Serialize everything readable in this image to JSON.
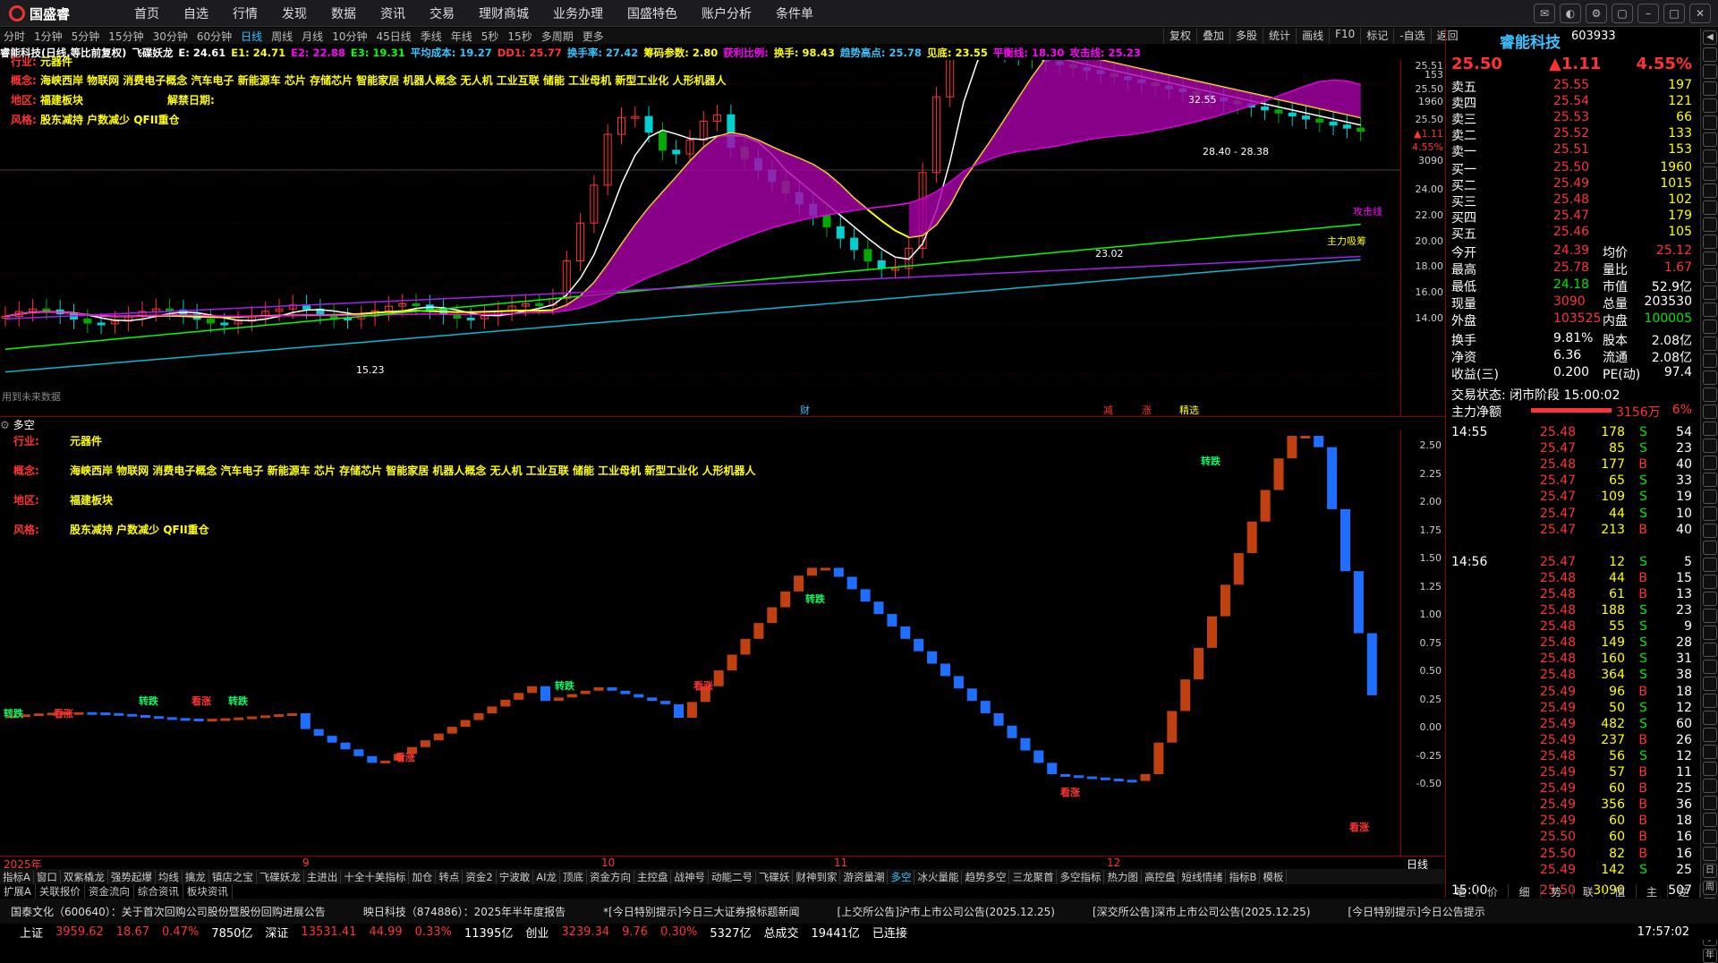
{
  "app": {
    "logo": "国盛睿"
  },
  "menu": [
    "首页",
    "自选",
    "行情",
    "发现",
    "数据",
    "资讯",
    "交易",
    "理财商城",
    "业务办理",
    "国盛特色",
    "账户分析",
    "条件单"
  ],
  "periods": [
    "分时",
    "1分钟",
    "5分钟",
    "15分钟",
    "30分钟",
    "60分钟",
    "日线",
    "周线",
    "月线",
    "10分钟",
    "45日线",
    "季线",
    "年线",
    "5秒",
    "15秒",
    "多周期",
    "更多"
  ],
  "active_period": "日线",
  "tools": [
    "复权",
    "叠加",
    "多股",
    "统计",
    "画线",
    "F10",
    "标记",
    "-自选",
    "返回"
  ],
  "ma_bar": [
    {
      "t": "睿能科技(日线,等比前复权)",
      "c": "#ffffff"
    },
    {
      "t": "飞碟妖龙",
      "c": "#ffffff"
    },
    {
      "t": "E: 24.61",
      "c": "#ffffff"
    },
    {
      "t": "E1: 24.71",
      "c": "#ffff00"
    },
    {
      "t": "E2: 22.88",
      "c": "#ff00ff"
    },
    {
      "t": "E3: 19.31",
      "c": "#00ff00"
    },
    {
      "t": "平均成本: 19.27",
      "c": "#37c3ff"
    },
    {
      "t": "DD1: 25.77",
      "c": "#ff3333"
    },
    {
      "t": "换手率: 27.42",
      "c": "#37c3ff"
    },
    {
      "t": "筹码参数: 2.80",
      "c": "#ffff00"
    },
    {
      "t": "获利比例:",
      "c": "#ff00ff"
    },
    {
      "t": "换手: 98.43",
      "c": "#ffff00"
    },
    {
      "t": "趋势高点: 25.78",
      "c": "#37c3ff"
    },
    {
      "t": "见底: 23.55",
      "c": "#ffff00"
    },
    {
      "t": "平衡线: 18.30",
      "c": "#ff00ff"
    },
    {
      "t": "攻击线: 25.23",
      "c": "#ff00ff"
    }
  ],
  "stock_info": {
    "industry_k": "行业:",
    "industry_v": "元器件",
    "concept_k": "概念:",
    "concept_v": "海峡西岸 物联网 消费电子概念 汽车电子 新能源车 芯片 存储芯片 智能家居 机器人概念 无人机 工业互联 储能 工业母机 新型工业化 人形机器人",
    "region_k": "地区:",
    "region_v": "福建板块",
    "unban_k": "解禁日期:",
    "style_k": "风格:",
    "style_v": "股东减持 户数减少 QFII重仓"
  },
  "kaxis": [
    "25.51",
    "153",
    "25.50",
    "1960",
    "25.50",
    "▲1.11",
    "4.55%",
    "3090",
    "24.00",
    "22.00",
    "20.00",
    "18.00",
    "16.00",
    "14.00"
  ],
  "k_labels": {
    "high": "32.55",
    "low": "15.23",
    "range": "28.40 - 28.38",
    "r2": "23.02",
    "nofuture": "用到未来数据",
    "attack": "攻击线",
    "mainforce": "主力吸筹",
    "jian": "减",
    "zhang": "涨",
    "cai": "财",
    "jingxuan": "精选"
  },
  "sub_title": "多空",
  "sub_axis": [
    "2.50",
    "2.25",
    "2.00",
    "1.75",
    "1.50",
    "1.25",
    "1.00",
    "0.75",
    "0.50",
    "0.25",
    "0.00",
    "-0.25",
    "-0.50"
  ],
  "sub_labels": {
    "up": "看涨",
    "down": "转跌"
  },
  "dates": [
    "2025年",
    "9",
    "10",
    "11",
    "12"
  ],
  "date_period": "日线",
  "ind_tabs": [
    "指标A",
    "窗口",
    "双紫橇龙",
    "强势起爆",
    "均线",
    "擒龙",
    "镇店之宝",
    "飞碟妖龙",
    "主进出",
    "十全十美指标",
    "加仓",
    "转点",
    "资金2",
    "宁波敢",
    "AI龙",
    "顶底",
    "资金方向",
    "主控盘",
    "战神号",
    "动能二号",
    "飞碟妖",
    "财神到家",
    "游资量潮",
    "多空",
    "冰火量能",
    "趋势多空",
    "三龙聚首",
    "多空指标",
    "热力图",
    "高控盘",
    "短线情绪",
    "指标B",
    "模板"
  ],
  "bot_tabs": [
    "扩展A",
    "关联报价",
    "资金流向",
    "综合资讯",
    "板块资讯"
  ],
  "ticker": [
    "国泰文化（600640）：关于首次回购公司股份暨股份回购进展公告",
    "映日科技（874886）：2025年半年度报告",
    "*[今日特别提示]今日三大证券报标题新闻",
    "[上交所公告]沪市上市公司公告(2025.12.25)",
    "[深交所公告]深市上市公司公告(2025.12.25)",
    "[今日特别提示]今日公告提示"
  ],
  "status": {
    "sh": "上证",
    "sh_v": "3959.62",
    "sh_c": "18.67",
    "sh_p": "0.47%",
    "sh_a": "7850亿",
    "sz": "深证",
    "sz_v": "13531.41",
    "sz_c": "44.99",
    "sz_p": "0.33%",
    "sz_a": "11395亿",
    "cy": "创业",
    "cy_v": "3239.34",
    "cy_c": "9.76",
    "cy_p": "0.30%",
    "cy_a": "5327亿",
    "total": "总成交",
    "total_v": "19441亿",
    "conn": "已连接",
    "time": "17:57:02"
  },
  "quote": {
    "name": "睿能科技",
    "code": "603933",
    "price": "25.50",
    "change": "▲1.11",
    "pct": "4.55%",
    "asks": [
      [
        "卖五",
        "25.55",
        "197"
      ],
      [
        "卖四",
        "25.54",
        "121"
      ],
      [
        "卖三",
        "25.53",
        "66"
      ],
      [
        "卖二",
        "25.52",
        "133"
      ],
      [
        "卖一",
        "25.51",
        "153"
      ]
    ],
    "bids": [
      [
        "买一",
        "25.50",
        "1960"
      ],
      [
        "买二",
        "25.49",
        "1015"
      ],
      [
        "买三",
        "25.48",
        "102"
      ],
      [
        "买四",
        "25.47",
        "179"
      ],
      [
        "买五",
        "25.46",
        "105"
      ]
    ],
    "stats": [
      [
        "今开",
        "24.39",
        "均价",
        "25.12"
      ],
      [
        "最高",
        "25.78",
        "量比",
        "1.67"
      ],
      [
        "最低",
        "24.18",
        "市值",
        "52.9亿"
      ],
      [
        "现量",
        "3090",
        "总量",
        "203530"
      ],
      [
        "外盘",
        "103525",
        "内盘",
        "100005"
      ]
    ],
    "stats2": [
      [
        "换手",
        "9.81%",
        "股本",
        "2.08亿"
      ],
      [
        "净资",
        "6.36",
        "流通",
        "2.08亿"
      ],
      [
        "收益(三)",
        "0.200",
        "PE(动)",
        "97.4"
      ]
    ],
    "trade_state": "交易状态: 闭市阶段 15:00:02",
    "mainnet_k": "主力净额",
    "mainnet_v": "3156万",
    "mainnet_p": "6%"
  },
  "ticks": [
    {
      "t": "14:55",
      "p": "25.48",
      "v": "178",
      "s": "S",
      "n": "54"
    },
    {
      "t": "",
      "p": "25.47",
      "v": "85",
      "s": "S",
      "n": "23"
    },
    {
      "t": "",
      "p": "25.48",
      "v": "177",
      "s": "B",
      "n": "40"
    },
    {
      "t": "",
      "p": "25.47",
      "v": "65",
      "s": "S",
      "n": "33"
    },
    {
      "t": "",
      "p": "25.47",
      "v": "109",
      "s": "S",
      "n": "19"
    },
    {
      "t": "",
      "p": "25.47",
      "v": "44",
      "s": "S",
      "n": "10"
    },
    {
      "t": "",
      "p": "25.47",
      "v": "213",
      "s": "B",
      "n": "40"
    },
    {
      "t": "14:56",
      "p": "25.47",
      "v": "12",
      "s": "S",
      "n": "5"
    },
    {
      "t": "",
      "p": "25.48",
      "v": "44",
      "s": "B",
      "n": "15"
    },
    {
      "t": "",
      "p": "25.48",
      "v": "61",
      "s": "B",
      "n": "13"
    },
    {
      "t": "",
      "p": "25.48",
      "v": "188",
      "s": "S",
      "n": "23"
    },
    {
      "t": "",
      "p": "25.48",
      "v": "55",
      "s": "S",
      "n": "9"
    },
    {
      "t": "",
      "p": "25.48",
      "v": "149",
      "s": "S",
      "n": "28"
    },
    {
      "t": "",
      "p": "25.48",
      "v": "160",
      "s": "S",
      "n": "31"
    },
    {
      "t": "",
      "p": "25.48",
      "v": "364",
      "s": "S",
      "n": "38"
    },
    {
      "t": "",
      "p": "25.49",
      "v": "96",
      "s": "B",
      "n": "18"
    },
    {
      "t": "",
      "p": "25.49",
      "v": "50",
      "s": "S",
      "n": "12"
    },
    {
      "t": "",
      "p": "25.49",
      "v": "482",
      "s": "S",
      "n": "60"
    },
    {
      "t": "",
      "p": "25.49",
      "v": "237",
      "s": "B",
      "n": "26"
    },
    {
      "t": "",
      "p": "25.48",
      "v": "56",
      "s": "S",
      "n": "12"
    },
    {
      "t": "",
      "p": "25.49",
      "v": "57",
      "s": "B",
      "n": "11"
    },
    {
      "t": "",
      "p": "25.49",
      "v": "60",
      "s": "B",
      "n": "25"
    },
    {
      "t": "",
      "p": "25.49",
      "v": "356",
      "s": "B",
      "n": "36"
    },
    {
      "t": "",
      "p": "25.49",
      "v": "60",
      "s": "B",
      "n": "18"
    },
    {
      "t": "",
      "p": "25.50",
      "v": "60",
      "s": "B",
      "n": "16"
    },
    {
      "t": "",
      "p": "25.50",
      "v": "82",
      "s": "B",
      "n": "16"
    },
    {
      "t": "",
      "p": "25.49",
      "v": "142",
      "s": "S",
      "n": "25"
    },
    {
      "t": "15:00",
      "p": "25.50",
      "v": "3090",
      "s": "",
      "n": "507"
    }
  ],
  "rb_tabs": [
    "笔",
    "价",
    "细",
    "势",
    "联",
    "值",
    "主",
    "逆"
  ],
  "side": [
    "◀",
    "",
    "",
    "",
    "",
    "",
    "",
    "",
    "",
    "",
    "",
    "",
    "",
    "",
    "",
    "",
    "",
    "",
    "",
    "",
    "",
    "",
    "",
    "",
    "",
    "",
    "",
    "",
    "",
    "",
    "",
    "",
    "",
    "",
    "",
    "",
    "",
    "",
    "",
    "",
    "",
    "",
    "",
    "",
    "",
    "",
    "",
    "",
    "",
    "日",
    "周",
    "月",
    "多",
    "季",
    "年"
  ]
}
